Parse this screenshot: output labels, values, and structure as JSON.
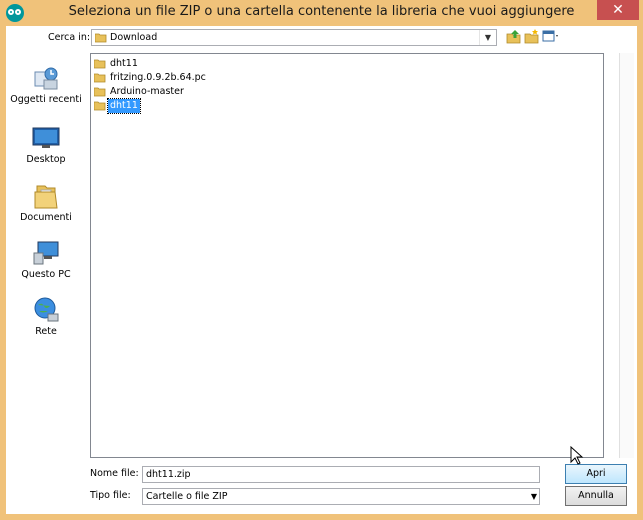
{
  "window": {
    "title": "Seleziona un file ZIP o una cartella contenente la libreria che vuoi aggiungere",
    "app_icon": "arduino-icon",
    "close_glyph": "✕"
  },
  "look_in": {
    "label": "Cerca in:",
    "value": "Download"
  },
  "toolbar": {
    "up": "up-folder-icon",
    "new_folder": "new-folder-icon",
    "views": "view-menu-icon"
  },
  "places": [
    {
      "label": "Oggetti recenti",
      "icon": "recent-items-icon"
    },
    {
      "label": "Desktop",
      "icon": "desktop-icon"
    },
    {
      "label": "Documenti",
      "icon": "documents-icon"
    },
    {
      "label": "Questo PC",
      "icon": "computer-icon"
    },
    {
      "label": "Rete",
      "icon": "network-icon"
    }
  ],
  "files": [
    {
      "name": "dht11",
      "selected": false
    },
    {
      "name": "fritzing.0.9.2b.64.pc",
      "selected": false
    },
    {
      "name": "Arduino-master",
      "selected": false
    },
    {
      "name": "dht11",
      "selected": true
    }
  ],
  "file_name": {
    "label": "Nome file:",
    "value": "dht11.zip"
  },
  "file_type": {
    "label": "Tipo file:",
    "value": "Cartelle o file ZIP"
  },
  "buttons": {
    "open": "Apri",
    "cancel": "Annulla"
  },
  "colors": {
    "title_bar": "#f0c27a",
    "selection": "#3399ff",
    "close_button": "#c75050"
  }
}
